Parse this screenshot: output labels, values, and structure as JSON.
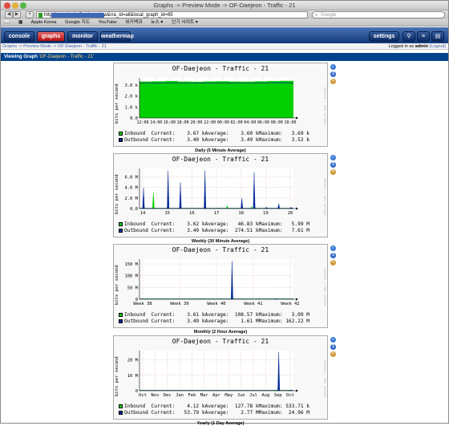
{
  "browser": {
    "title": "Graphs -> Preview Mode -> OF-Daejeon - Traffic - 21",
    "url": "http://                    graph.php?action=view&rra_id=all&local_graph_id=65",
    "search_placeholder": "Google",
    "bookmarks": [
      "Apple Korea",
      "Google 지도",
      "YouTube",
      "위키백과",
      "뉴스 ▾",
      "인기 사이트 ▾"
    ]
  },
  "cacti": {
    "tabs": [
      "console",
      "graphs",
      "monitor",
      "weathermap"
    ],
    "right_buttons": [
      "settings"
    ],
    "breadcrumb": "Graphs -> Preview Mode -> OF-Daejeon - Traffic - 21",
    "logged_in_prefix": "Logged in as ",
    "user": "admin",
    "logout": "(Logout)",
    "viewing_label": "Viewing Graph",
    "viewing_title": "'OF-Daejeon - Traffic - 21'"
  },
  "colors": {
    "inbound": "#00cf00",
    "outbound": "#002a97",
    "header": "#00438c",
    "active_tab": "#d01818"
  },
  "graphs": [
    {
      "title": "OF-Daejeon - Traffic - 21",
      "ylabel": "bits per second",
      "caption": "Daily (5 Minute Average)",
      "legend": [
        [
          "Inbound",
          "Current:",
          "3.67 k",
          "Average:",
          "3.60 k",
          "Maximum:",
          "3.69 k"
        ],
        [
          "Outbound",
          "Current:",
          "3.49 k",
          "Average:",
          "3.49 k",
          "Maximum:",
          "3.52 k"
        ]
      ],
      "chart_data": {
        "type": "area",
        "y_ticks": [
          "0.0",
          "1.0 k",
          "2.0 k",
          "3.0 k"
        ],
        "ylim": [
          0,
          4
        ],
        "x_ticks": [
          "12:00",
          "14:00",
          "16:00",
          "18:00",
          "20:00",
          "22:00",
          "00:00",
          "02:00",
          "04:00",
          "06:00",
          "08:00",
          "10:00"
        ],
        "series": [
          {
            "name": "Inbound",
            "values": [
              3.6,
              3.62,
              3.65,
              3.6,
              3.58,
              3.61,
              3.63,
              3.6,
              3.59,
              3.62,
              3.65,
              3.67
            ]
          },
          {
            "name": "Outbound",
            "values": [
              3.49,
              3.49,
              3.5,
              3.49,
              3.48,
              3.49,
              3.5,
              3.49,
              3.49,
              3.5,
              3.52,
              3.49
            ]
          }
        ]
      }
    },
    {
      "title": "OF-Daejeon - Traffic - 21",
      "ylabel": "bits per second",
      "caption": "Weekly (30 Minute Average)",
      "legend": [
        [
          "Inbound",
          "Current:",
          "3.62 k",
          "Average:",
          "46.83 k",
          "Maximum:",
          "5.99 M"
        ],
        [
          "Outbound",
          "Current:",
          "3.49 k",
          "Average:",
          "274.51 k",
          "Maximum:",
          "7.61 M"
        ]
      ],
      "chart_data": {
        "type": "line",
        "y_ticks": [
          "0.0",
          "2.0 M",
          "4.0 M",
          "6.0 M"
        ],
        "ylim": [
          0,
          8
        ],
        "x_ticks": [
          "14",
          "15",
          "16",
          "17",
          "18",
          "19",
          "20"
        ],
        "series": [
          {
            "name": "Inbound",
            "values": [
              0,
              3.2,
              0,
              0,
              0,
              0,
              0,
              0.6,
              0,
              0.4,
              0,
              0,
              0
            ]
          },
          {
            "name": "Outbound",
            "values": [
              4.1,
              0,
              7.5,
              5.2,
              0,
              7.6,
              0,
              0,
              2.1,
              7.2,
              0.3,
              1.0,
              0.3
            ]
          }
        ]
      }
    },
    {
      "title": "OF-Daejeon - Traffic - 21",
      "ylabel": "bits per second",
      "caption": "Monthly (2 Hour Average)",
      "legend": [
        [
          "Inbound",
          "Current:",
          "3.61 k",
          "Average:",
          "108.57 k",
          "Maximum:",
          "3.09 M"
        ],
        [
          "Outbound",
          "Current:",
          "3.49 k",
          "Average:",
          "1.61 M",
          "Maximum:",
          "162.22 M"
        ]
      ],
      "chart_data": {
        "type": "line",
        "y_ticks": [
          "0",
          "50 M",
          "100 M",
          "150 M"
        ],
        "ylim": [
          0,
          170
        ],
        "x_ticks": [
          "Week 38",
          "Week 39",
          "Week 40",
          "Week 41",
          "Week 42"
        ],
        "series": [
          {
            "name": "Inbound",
            "values": [
              0,
              0,
              0,
              0,
              0,
              0,
              0,
              0,
              3,
              0,
              0
            ]
          },
          {
            "name": "Outbound",
            "values": [
              0,
              0,
              0,
              0,
              0,
              0,
              162,
              0,
              0,
              2,
              0
            ]
          }
        ]
      }
    },
    {
      "title": "OF-Daejeon - Traffic - 21",
      "ylabel": "bits per second",
      "caption": "Yearly (1 Day Average)",
      "legend": [
        [
          "Inbound",
          "Current:",
          "4.12 k",
          "Average:",
          "127.78 k",
          "Maximum:",
          "533.71 k"
        ],
        [
          "Outbound",
          "Current:",
          "53.79 k",
          "Average:",
          "2.77 M",
          "Maximum:",
          "24.96 M"
        ]
      ],
      "chart_data": {
        "type": "line",
        "y_ticks": [
          "0",
          "10 M",
          "20 M"
        ],
        "ylim": [
          0,
          26
        ],
        "x_ticks": [
          "Oct",
          "Nov",
          "Dec",
          "Jan",
          "Feb",
          "Mar",
          "Apr",
          "May",
          "Jun",
          "Jul",
          "Aug",
          "Sep",
          "Oct"
        ],
        "series": [
          {
            "name": "Inbound",
            "values": [
              0,
              0,
              0,
              0,
              0,
              0,
              0,
              0,
              0,
              0,
              0,
              0.5,
              0.1
            ]
          },
          {
            "name": "Outbound",
            "values": [
              0,
              0,
              0,
              0,
              0,
              0,
              0,
              0,
              0,
              0,
              0,
              25,
              0.5
            ]
          }
        ]
      }
    }
  ]
}
